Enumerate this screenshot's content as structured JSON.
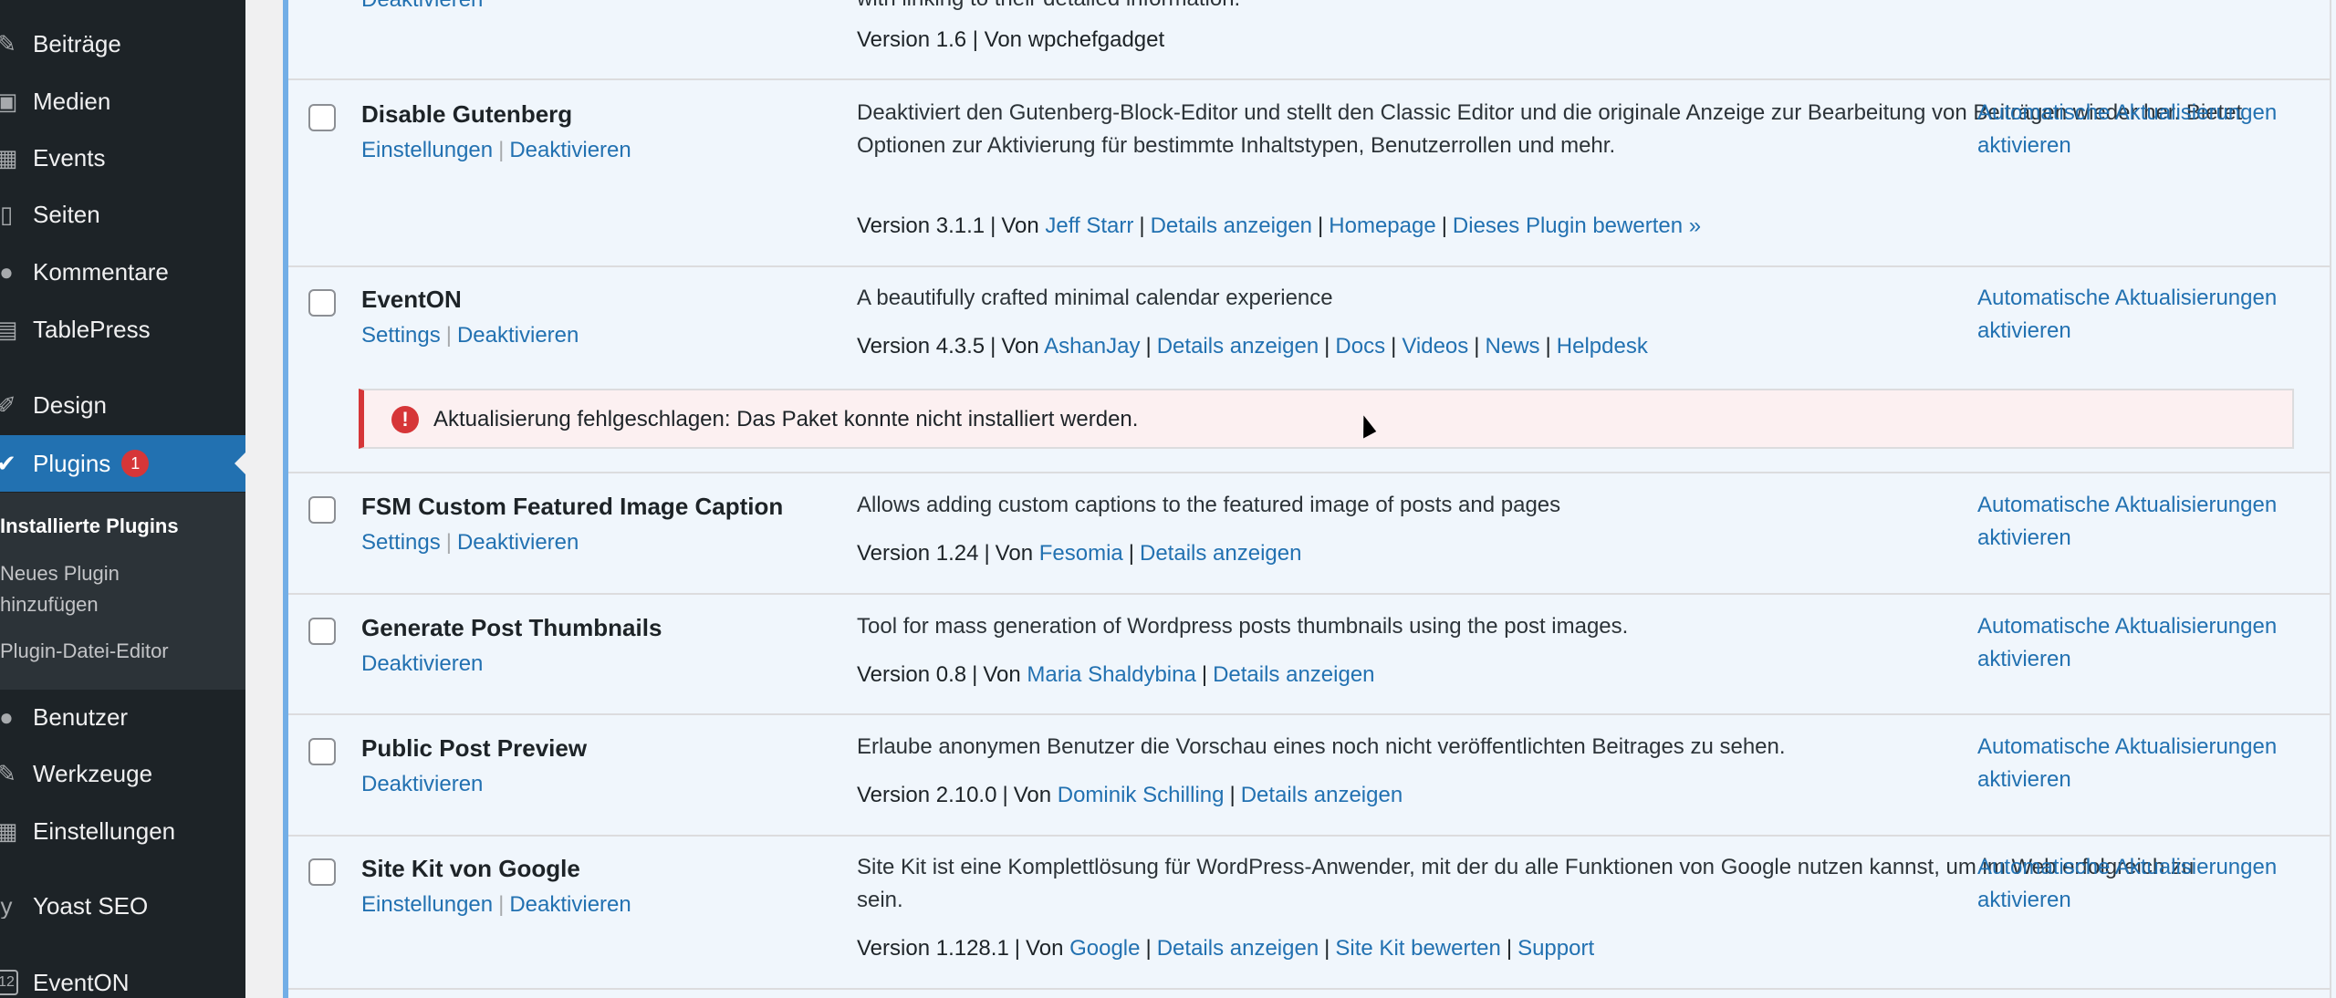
{
  "sidebar": {
    "items": [
      {
        "label": "Beiträge",
        "icon": "pin-icon"
      },
      {
        "label": "Medien",
        "icon": "media-icon"
      },
      {
        "label": "Events",
        "icon": "calendar-icon"
      },
      {
        "label": "Seiten",
        "icon": "page-icon"
      },
      {
        "label": "Kommentare",
        "icon": "comment-icon"
      },
      {
        "label": "TablePress",
        "icon": "table-icon"
      },
      {
        "label": "Design",
        "icon": "brush-icon"
      },
      {
        "label": "Plugins",
        "icon": "plugin-icon",
        "badge": "1"
      },
      {
        "label": "Benutzer",
        "icon": "user-icon"
      },
      {
        "label": "Werkzeuge",
        "icon": "wrench-icon"
      },
      {
        "label": "Einstellungen",
        "icon": "settings-icon"
      },
      {
        "label": "Yoast SEO",
        "icon": "yoast-icon"
      },
      {
        "label": "EventON",
        "icon": "eventon-icon",
        "icon_text": "12"
      }
    ],
    "submenu": {
      "installed": "Installierte Plugins",
      "add_new_line1": "Neues Plugin",
      "add_new_line2": "hinzufügen",
      "editor": "Plugin-Datei-Editor"
    }
  },
  "prev_row": {
    "action": "Deaktivieren",
    "desc": "with linking to their detailed information.",
    "version_text": "Version 1.6 | Von wpchefgadget"
  },
  "plugins": [
    {
      "name": "Disable Gutenberg",
      "actions": [
        "Einstellungen",
        "Deaktivieren"
      ],
      "description": "Deaktiviert den Gutenberg-Block-Editor und stellt den Classic Editor und die originale Anzeige zur Bearbeitung von Beiträgen wieder her. Bietet Optionen zur Aktivierung für bestimmte Inhaltstypen, Benutzerrollen und mehr.",
      "version": "Version 3.1.1",
      "by": "Von",
      "author": "Jeff Starr",
      "links": [
        "Details anzeigen",
        "Homepage",
        "Dieses Plugin bewerten »"
      ],
      "auto_update": "Automatische Aktualisierungen aktivieren"
    },
    {
      "name": "EventON",
      "actions": [
        "Settings",
        "Deaktivieren"
      ],
      "description": "A beautifully crafted minimal calendar experience",
      "version": "Version 4.3.5",
      "by": "Von",
      "author": "AshanJay",
      "links": [
        "Details anzeigen",
        "Docs",
        "Videos",
        "News",
        "Helpdesk"
      ],
      "auto_update": "Automatische Aktualisierungen aktivieren"
    },
    {
      "name": "FSM Custom Featured Image Caption",
      "actions": [
        "Settings",
        "Deaktivieren"
      ],
      "description": "Allows adding custom captions to the featured image of posts and pages",
      "version": "Version 1.24",
      "by": "Von",
      "author": "Fesomia",
      "links": [
        "Details anzeigen"
      ],
      "auto_update": "Automatische Aktualisierungen aktivieren"
    },
    {
      "name": "Generate Post Thumbnails",
      "actions": [
        "Deaktivieren"
      ],
      "description": "Tool for mass generation of Wordpress posts thumbnails using the post images.",
      "version": "Version 0.8",
      "by": "Von",
      "author": "Maria Shaldybina",
      "links": [
        "Details anzeigen"
      ],
      "auto_update": "Automatische Aktualisierungen aktivieren"
    },
    {
      "name": "Public Post Preview",
      "actions": [
        "Deaktivieren"
      ],
      "description": "Erlaube anonymen Benutzer die Vorschau eines noch nicht veröffentlichten Beitrages zu sehen.",
      "version": "Version 2.10.0",
      "by": "Von",
      "author": "Dominik Schilling",
      "links": [
        "Details anzeigen"
      ],
      "auto_update": "Automatische Aktualisierungen aktivieren"
    },
    {
      "name": "Site Kit von Google",
      "actions": [
        "Einstellungen",
        "Deaktivieren"
      ],
      "description": "Site Kit ist eine Komplettlösung für WordPress-Anwender, mit der du alle Funktionen von Google nutzen kannst, um im Web erfolgreich zu sein.",
      "version": "Version 1.128.1",
      "by": "Von",
      "author": "Google",
      "links": [
        "Details anzeigen",
        "Site Kit bewerten",
        "Support"
      ],
      "auto_update": "Automatische Aktualisierungen aktivieren"
    }
  ],
  "error_notice": "Aktualisierung fehlgeschlagen: Das Paket konnte nicht installiert werden.",
  "colors": {
    "accent": "#2271b1",
    "error": "#d63638",
    "sidebar": "#1d2327"
  }
}
